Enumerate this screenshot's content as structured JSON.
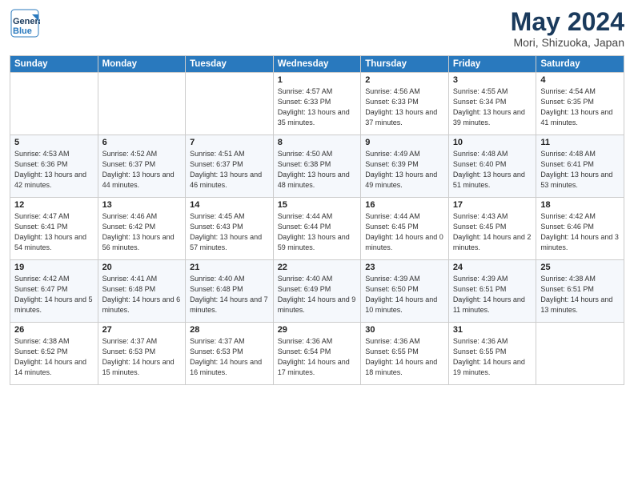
{
  "logo": {
    "line1": "General",
    "line2": "Blue"
  },
  "title": "May 2024",
  "subtitle": "Mori, Shizuoka, Japan",
  "weekdays": [
    "Sunday",
    "Monday",
    "Tuesday",
    "Wednesday",
    "Thursday",
    "Friday",
    "Saturday"
  ],
  "weeks": [
    [
      {
        "day": "",
        "info": ""
      },
      {
        "day": "",
        "info": ""
      },
      {
        "day": "",
        "info": ""
      },
      {
        "day": "1",
        "info": "Sunrise: 4:57 AM\nSunset: 6:33 PM\nDaylight: 13 hours\nand 35 minutes."
      },
      {
        "day": "2",
        "info": "Sunrise: 4:56 AM\nSunset: 6:33 PM\nDaylight: 13 hours\nand 37 minutes."
      },
      {
        "day": "3",
        "info": "Sunrise: 4:55 AM\nSunset: 6:34 PM\nDaylight: 13 hours\nand 39 minutes."
      },
      {
        "day": "4",
        "info": "Sunrise: 4:54 AM\nSunset: 6:35 PM\nDaylight: 13 hours\nand 41 minutes."
      }
    ],
    [
      {
        "day": "5",
        "info": "Sunrise: 4:53 AM\nSunset: 6:36 PM\nDaylight: 13 hours\nand 42 minutes."
      },
      {
        "day": "6",
        "info": "Sunrise: 4:52 AM\nSunset: 6:37 PM\nDaylight: 13 hours\nand 44 minutes."
      },
      {
        "day": "7",
        "info": "Sunrise: 4:51 AM\nSunset: 6:37 PM\nDaylight: 13 hours\nand 46 minutes."
      },
      {
        "day": "8",
        "info": "Sunrise: 4:50 AM\nSunset: 6:38 PM\nDaylight: 13 hours\nand 48 minutes."
      },
      {
        "day": "9",
        "info": "Sunrise: 4:49 AM\nSunset: 6:39 PM\nDaylight: 13 hours\nand 49 minutes."
      },
      {
        "day": "10",
        "info": "Sunrise: 4:48 AM\nSunset: 6:40 PM\nDaylight: 13 hours\nand 51 minutes."
      },
      {
        "day": "11",
        "info": "Sunrise: 4:48 AM\nSunset: 6:41 PM\nDaylight: 13 hours\nand 53 minutes."
      }
    ],
    [
      {
        "day": "12",
        "info": "Sunrise: 4:47 AM\nSunset: 6:41 PM\nDaylight: 13 hours\nand 54 minutes."
      },
      {
        "day": "13",
        "info": "Sunrise: 4:46 AM\nSunset: 6:42 PM\nDaylight: 13 hours\nand 56 minutes."
      },
      {
        "day": "14",
        "info": "Sunrise: 4:45 AM\nSunset: 6:43 PM\nDaylight: 13 hours\nand 57 minutes."
      },
      {
        "day": "15",
        "info": "Sunrise: 4:44 AM\nSunset: 6:44 PM\nDaylight: 13 hours\nand 59 minutes."
      },
      {
        "day": "16",
        "info": "Sunrise: 4:44 AM\nSunset: 6:45 PM\nDaylight: 14 hours\nand 0 minutes."
      },
      {
        "day": "17",
        "info": "Sunrise: 4:43 AM\nSunset: 6:45 PM\nDaylight: 14 hours\nand 2 minutes."
      },
      {
        "day": "18",
        "info": "Sunrise: 4:42 AM\nSunset: 6:46 PM\nDaylight: 14 hours\nand 3 minutes."
      }
    ],
    [
      {
        "day": "19",
        "info": "Sunrise: 4:42 AM\nSunset: 6:47 PM\nDaylight: 14 hours\nand 5 minutes."
      },
      {
        "day": "20",
        "info": "Sunrise: 4:41 AM\nSunset: 6:48 PM\nDaylight: 14 hours\nand 6 minutes."
      },
      {
        "day": "21",
        "info": "Sunrise: 4:40 AM\nSunset: 6:48 PM\nDaylight: 14 hours\nand 7 minutes."
      },
      {
        "day": "22",
        "info": "Sunrise: 4:40 AM\nSunset: 6:49 PM\nDaylight: 14 hours\nand 9 minutes."
      },
      {
        "day": "23",
        "info": "Sunrise: 4:39 AM\nSunset: 6:50 PM\nDaylight: 14 hours\nand 10 minutes."
      },
      {
        "day": "24",
        "info": "Sunrise: 4:39 AM\nSunset: 6:51 PM\nDaylight: 14 hours\nand 11 minutes."
      },
      {
        "day": "25",
        "info": "Sunrise: 4:38 AM\nSunset: 6:51 PM\nDaylight: 14 hours\nand 13 minutes."
      }
    ],
    [
      {
        "day": "26",
        "info": "Sunrise: 4:38 AM\nSunset: 6:52 PM\nDaylight: 14 hours\nand 14 minutes."
      },
      {
        "day": "27",
        "info": "Sunrise: 4:37 AM\nSunset: 6:53 PM\nDaylight: 14 hours\nand 15 minutes."
      },
      {
        "day": "28",
        "info": "Sunrise: 4:37 AM\nSunset: 6:53 PM\nDaylight: 14 hours\nand 16 minutes."
      },
      {
        "day": "29",
        "info": "Sunrise: 4:36 AM\nSunset: 6:54 PM\nDaylight: 14 hours\nand 17 minutes."
      },
      {
        "day": "30",
        "info": "Sunrise: 4:36 AM\nSunset: 6:55 PM\nDaylight: 14 hours\nand 18 minutes."
      },
      {
        "day": "31",
        "info": "Sunrise: 4:36 AM\nSunset: 6:55 PM\nDaylight: 14 hours\nand 19 minutes."
      },
      {
        "day": "",
        "info": ""
      }
    ]
  ]
}
